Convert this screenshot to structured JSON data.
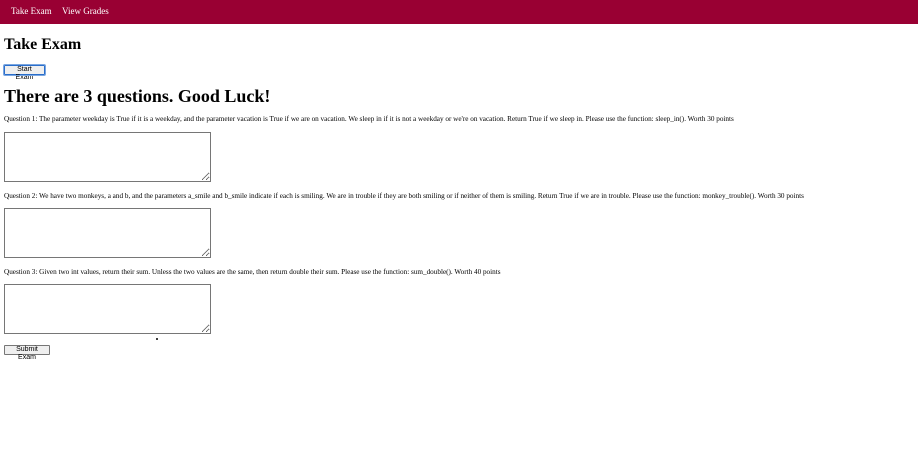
{
  "nav": {
    "items": [
      {
        "label": "Take Exam"
      },
      {
        "label": "View Grades"
      }
    ]
  },
  "page": {
    "title": "Take Exam",
    "start_button": "Start Exam",
    "subtitle": "There are 3 questions. Good Luck!",
    "submit_button": "Submit Exam"
  },
  "questions": [
    {
      "text": "Question 1: The parameter weekday is True if it is a weekday, and the parameter vacation is True if we are on vacation. We sleep in if it is not a weekday or we're on vacation. Return True if we sleep in. Please use the function: sleep_in(). Worth 30 points",
      "answer": ""
    },
    {
      "text": "Question 2: We have two monkeys, a and b, and the parameters a_smile and b_smile indicate if each is smiling. We are in trouble if they are both smiling or if neither of them is smiling. Return True if we are in trouble. Please use the function: monkey_trouble(). Worth 30 points",
      "answer": ""
    },
    {
      "text": "Question 3: Given two int values, return their sum. Unless the two values are the same, then return double their sum. Please use the function: sum_double(). Worth 40 points",
      "answer": ""
    }
  ],
  "colors": {
    "navbar": "#990033",
    "nav_text": "#ffffff"
  }
}
